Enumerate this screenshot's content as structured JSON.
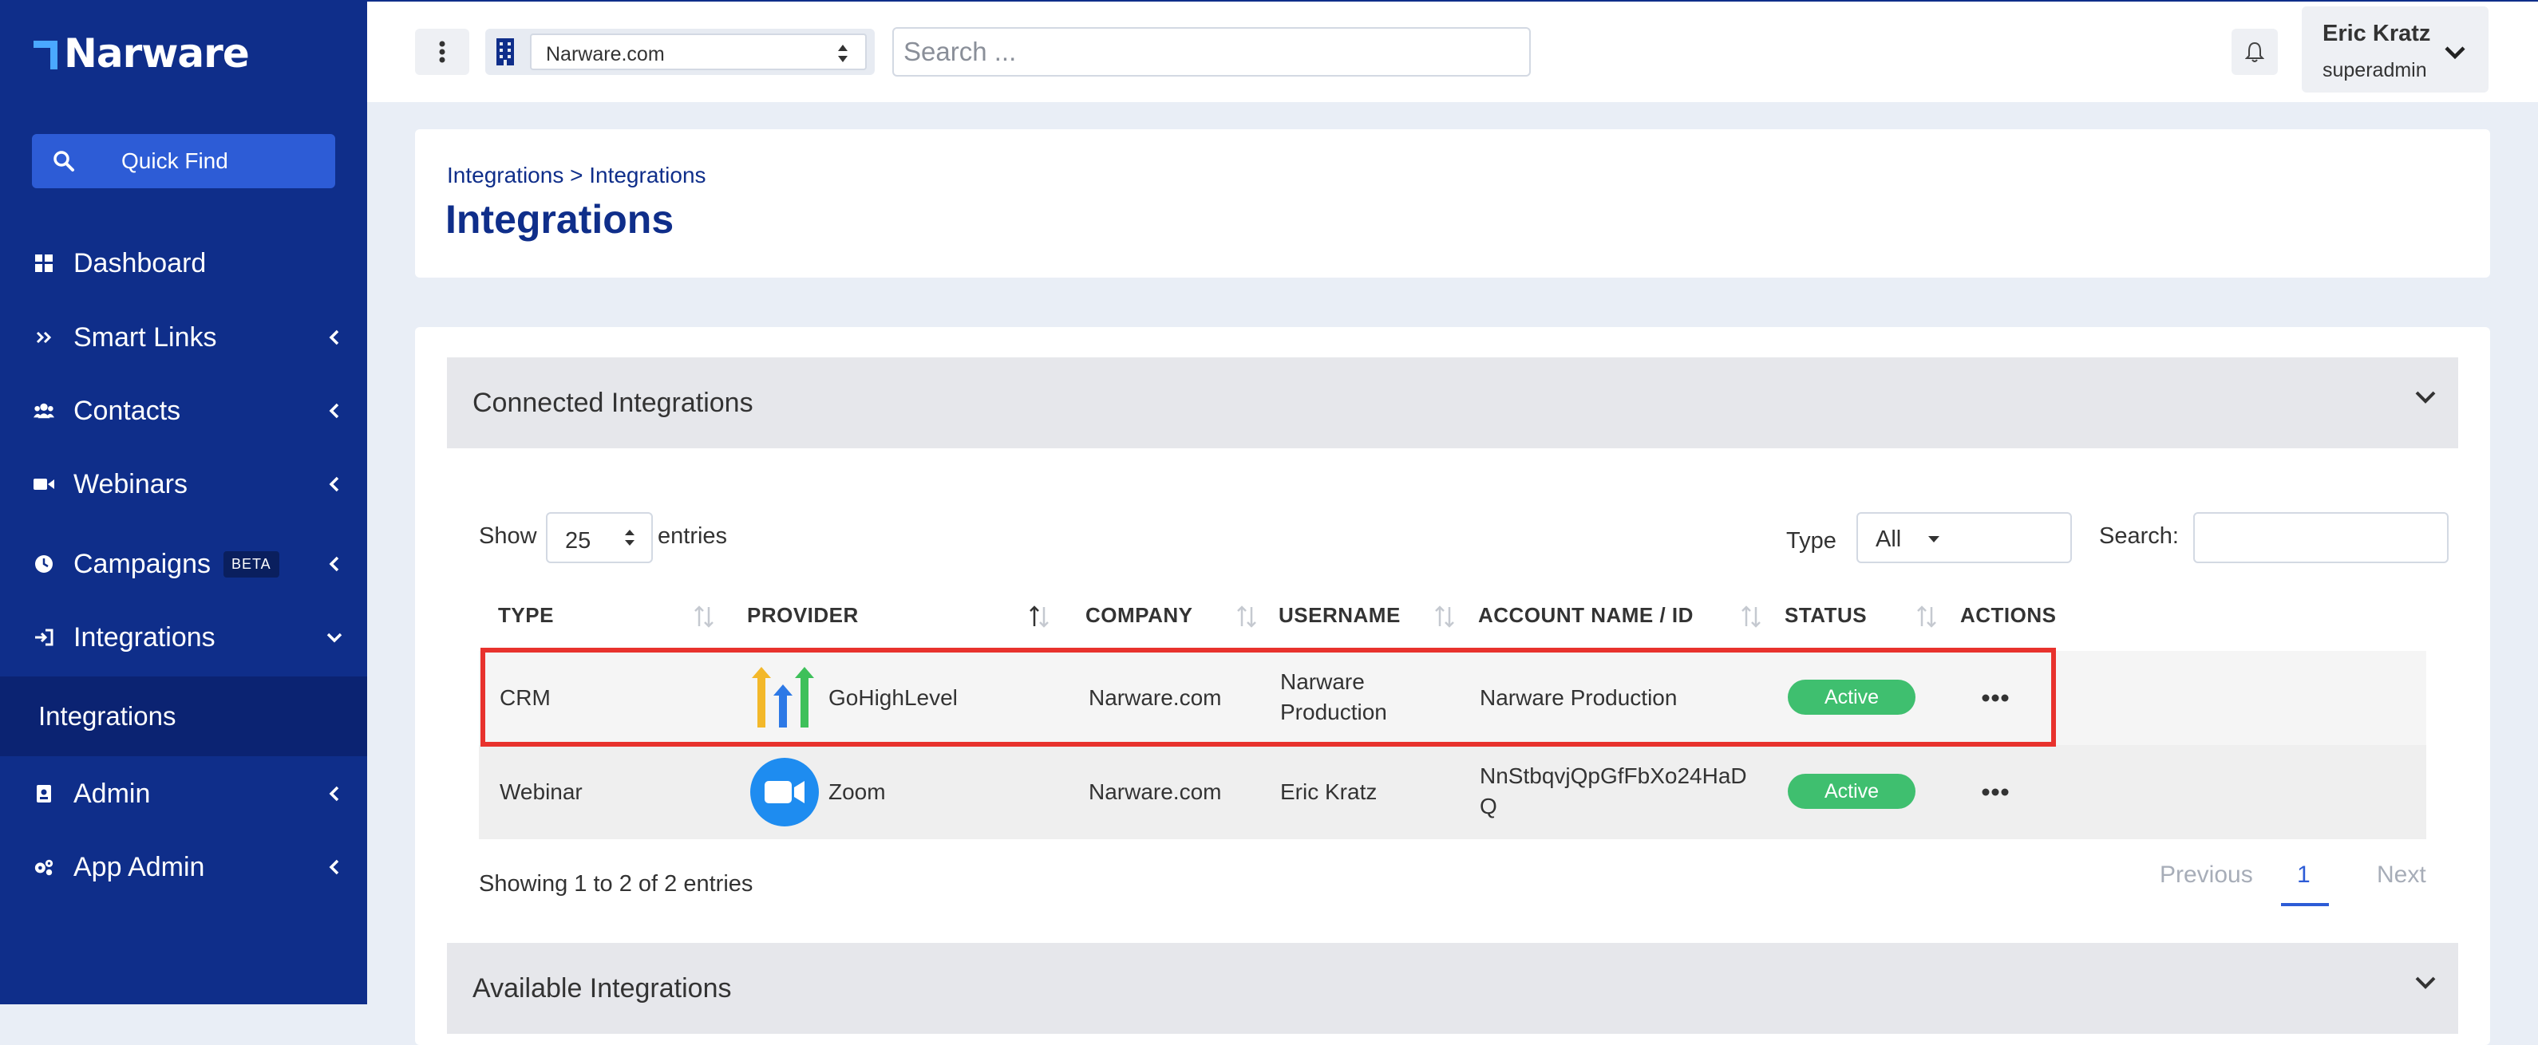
{
  "brand": {
    "name": "Narware"
  },
  "sidebar": {
    "quick_find": "Quick Find",
    "items": [
      {
        "label": "Dashboard",
        "icon": "dashboard-icon"
      },
      {
        "label": "Smart Links",
        "icon": "double-chevron-icon"
      },
      {
        "label": "Contacts",
        "icon": "users-icon"
      },
      {
        "label": "Webinars",
        "icon": "video-icon"
      },
      {
        "label": "Campaigns",
        "icon": "clock-icon",
        "badge": "BETA"
      },
      {
        "label": "Integrations",
        "icon": "sign-in-icon"
      },
      {
        "label": "Admin",
        "icon": "id-badge-icon"
      },
      {
        "label": "App Admin",
        "icon": "gears-icon"
      }
    ],
    "active_sub": "Integrations"
  },
  "topbar": {
    "org_select": "Narware.com",
    "search_placeholder": "Search ...",
    "user_name": "Eric Kratz",
    "user_role": "superadmin"
  },
  "header": {
    "breadcrumb": "Integrations > Integrations",
    "title": "Integrations"
  },
  "connected": {
    "section_title": "Connected Integrations",
    "show_label": "Show",
    "entries_value": "25",
    "entries_label": "entries",
    "type_label": "Type",
    "type_value": "All",
    "search_label": "Search:",
    "columns": [
      "TYPE",
      "PROVIDER",
      "COMPANY",
      "USERNAME",
      "ACCOUNT NAME / ID",
      "STATUS",
      "ACTIONS"
    ],
    "rows": [
      {
        "type": "CRM",
        "provider": "GoHighLevel",
        "provider_icon": "gohighlevel-logo-icon",
        "company": "Narware.com",
        "username": "Narware Production",
        "account": "Narware Production",
        "status": "Active"
      },
      {
        "type": "Webinar",
        "provider": "Zoom",
        "provider_icon": "zoom-logo-icon",
        "company": "Narware.com",
        "username": "Eric Kratz",
        "account": "NnStbqvjQpGfFbXo24HaDQ",
        "status": "Active"
      }
    ],
    "showing": "Showing 1 to 2 of 2 entries",
    "pagination": {
      "previous": "Previous",
      "current": "1",
      "next": "Next"
    }
  },
  "available": {
    "section_title": "Available Integrations"
  },
  "colors": {
    "sidebar": "#0f2e8a",
    "accent": "#2d5cd6",
    "active_badge": "#3fbf6f",
    "highlight": "#e8322d"
  }
}
